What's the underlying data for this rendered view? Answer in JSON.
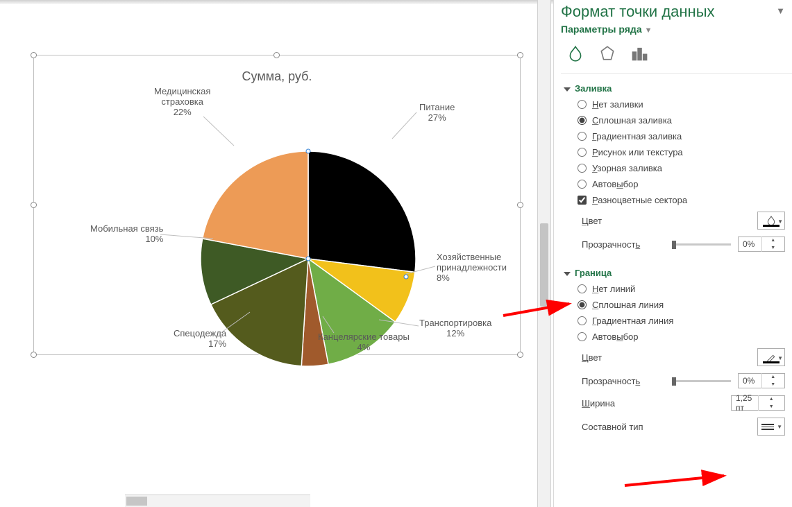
{
  "pane": {
    "title": "Формат точки данных",
    "sub_dropdown": "Параметры ряда",
    "fill": {
      "header": "Заливка",
      "none": "Нет заливки",
      "solid": "Сплошная заливка",
      "gradient": "Градиентная заливка",
      "picture": "Рисунок или текстура",
      "pattern": "Узорная заливка",
      "auto": "Автовыбор",
      "vary": "Разноцветные сектора",
      "color_label": "Цвет",
      "transparency_label": "Прозрачность",
      "transparency_value": "0%"
    },
    "border": {
      "header": "Граница",
      "none": "Нет линий",
      "solid": "Сплошная линия",
      "gradient": "Градиентная линия",
      "auto": "Автовыбор",
      "color_label": "Цвет",
      "transparency_label": "Прозрачность",
      "transparency_value": "0%",
      "width_label": "Ширина",
      "width_value": "1,25 пт",
      "compound_label": "Составной тип"
    }
  },
  "chart": {
    "title": "Сумма, руб.",
    "labels": {
      "pit": {
        "name": "Питание",
        "pct": "27%"
      },
      "hoz": {
        "name": "Хозяйственные\nпринадлежности",
        "pct": "8%"
      },
      "trn": {
        "name": "Транспортировка",
        "pct": "12%"
      },
      "knc": {
        "name": "Канцелярские товары",
        "pct": "4%"
      },
      "spc": {
        "name": "Спецодежда",
        "pct": "17%"
      },
      "mob": {
        "name": "Мобильная связь",
        "pct": "10%"
      },
      "med": {
        "name": "Медицинская\nстраховка",
        "pct": "22%"
      }
    }
  },
  "chart_data": {
    "type": "pie",
    "title": "Сумма, руб.",
    "series": [
      {
        "name": "Питание",
        "pct": 27,
        "color": "#000000"
      },
      {
        "name": "Хозяйственные принадлежности",
        "pct": 8,
        "color": "#f2c11b"
      },
      {
        "name": "Транспортировка",
        "pct": 12,
        "color": "#70ad47"
      },
      {
        "name": "Канцелярские товары",
        "pct": 4,
        "color": "#a05a2c"
      },
      {
        "name": "Спецодежда",
        "pct": 17,
        "color": "#545b1d"
      },
      {
        "name": "Мобильная связь",
        "pct": 10,
        "color": "#3e5a25"
      },
      {
        "name": "Медицинская страховка",
        "pct": 22,
        "color": "#ed9b56"
      }
    ]
  }
}
